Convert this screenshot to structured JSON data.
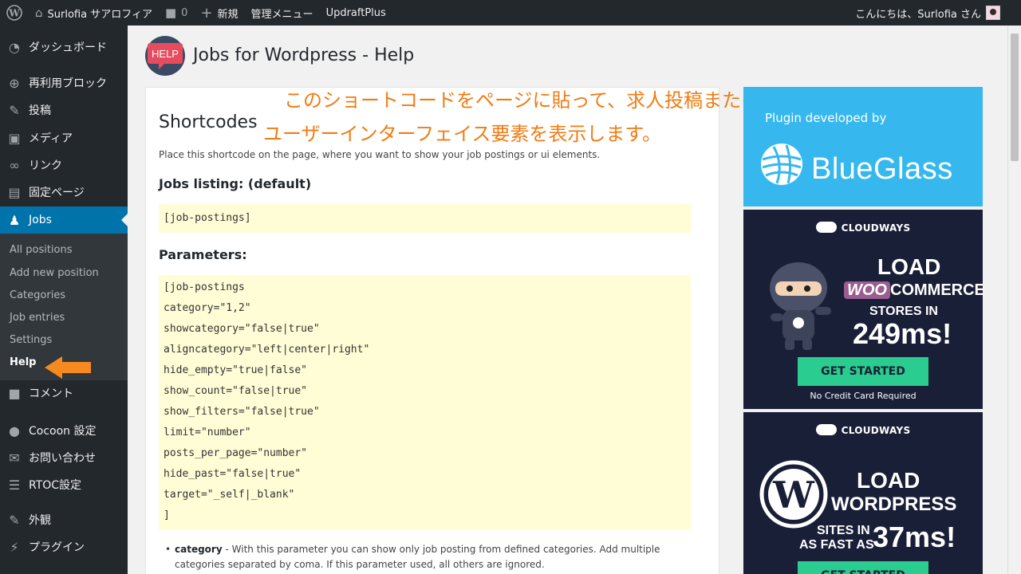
{
  "adminbar": {
    "site_name": "Surlofia サアロフィア",
    "comments_count": "0",
    "new_label": "新規",
    "manage_menu": "管理メニュー",
    "updraft": "UpdraftPlus",
    "greeting": "こんにちは、Surlofia さん"
  },
  "sidebar": {
    "items": [
      {
        "label": "ダッシュボード",
        "icon": "dashboard-icon"
      },
      {
        "label": "再利用ブロック",
        "icon": "reusable-block-icon"
      },
      {
        "label": "投稿",
        "icon": "pin-icon"
      },
      {
        "label": "メディア",
        "icon": "media-icon"
      },
      {
        "label": "リンク",
        "icon": "link-icon"
      },
      {
        "label": "固定ページ",
        "icon": "page-icon"
      },
      {
        "label": "Jobs",
        "icon": "jobs-icon"
      },
      {
        "label": "コメント",
        "icon": "comment-icon"
      },
      {
        "label": "Cocoon 設定",
        "icon": "cocoon-icon"
      },
      {
        "label": "お問い合わせ",
        "icon": "mail-icon"
      },
      {
        "label": "RTOC設定",
        "icon": "list-icon"
      },
      {
        "label": "外観",
        "icon": "brush-icon"
      },
      {
        "label": "プラグイン",
        "icon": "plugin-icon"
      }
    ],
    "submenu": [
      "All positions",
      "Add new position",
      "Categories",
      "Job entries",
      "Settings",
      "Help"
    ]
  },
  "page": {
    "badge_text": "HELP",
    "title": "Jobs for Wordpress - Help",
    "annotation_line1": "このショートコードをページに貼って、求人投稿または",
    "annotation_line2": "ユーザーインターフェイス要素を表示します。",
    "annotation_color": "#f07c14",
    "shortcodes_title": "Shortcodes",
    "intro": "Place this shortcode on the page, where you want to show your job postings or ui elements.",
    "listing_heading": "Jobs listing: (default)",
    "listing_code": "[job-postings]",
    "params_heading": "Parameters:",
    "params_code": [
      "[job-postings",
      "category=\"1,2\"",
      "showcategory=\"false|true\"",
      "aligncategory=\"left|center|right\"",
      "hide_empty=\"true|false\"",
      "show_count=\"false|true\"",
      "show_filters=\"false|true\"",
      "limit=\"number\"",
      "posts_per_page=\"number\"",
      "hide_past=\"false|true\"",
      "target=\"_self|_blank\"",
      "]"
    ],
    "param_note_name": "category",
    "param_note_text": " - With this parameter you can show only job posting from defined categories. Add multiple categories separated by coma. If this parameter used, all others are ignored."
  },
  "ads": {
    "blueglass_dev": "Plugin developed by",
    "blueglass_name": "BlueGlass",
    "cw_brand": "CLOUDWAYS",
    "cw1_load": "LOAD",
    "cw1_woo_w": "WOO",
    "cw1_woo_rest": "COMMERCE",
    "cw1_stores": "STORES IN",
    "cw1_ms": "249ms!",
    "cw1_button": "GET STARTED",
    "cw1_fine": "No Credit Card Required",
    "cw2_load": "LOAD",
    "cw2_wp": "WORDPRESS",
    "cw2_sites": "SITES IN",
    "cw2_fast": "AS FAST AS",
    "cw2_ms": "37ms!",
    "cw2_button": "GET STARTED"
  }
}
